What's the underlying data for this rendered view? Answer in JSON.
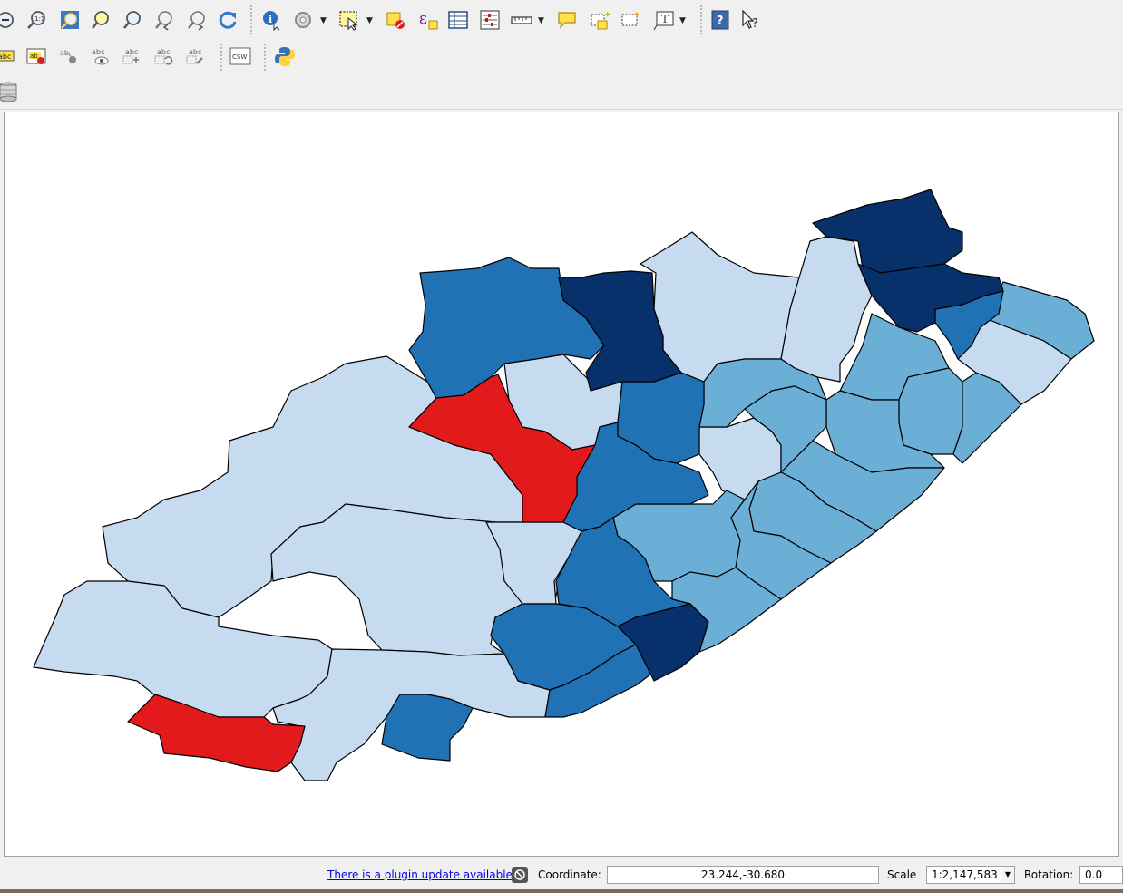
{
  "toolbar_row1": {
    "icons": [
      "zoom-out-icon",
      "zoom-native-resolution-icon",
      "zoom-full-icon",
      "zoom-to-selection-icon",
      "zoom-to-layer-icon",
      "zoom-last-icon",
      "zoom-next-icon",
      "refresh-icon",
      "identify-icon",
      "action-icon",
      "select-features-icon",
      "deselect-icon",
      "select-by-expression-icon",
      "attribute-table-icon",
      "statistical-summary-icon",
      "measure-icon",
      "map-tips-icon",
      "new-bookmark-icon",
      "show-bookmarks-icon",
      "text-annotation-icon",
      "help-icon",
      "whats-this-icon"
    ]
  },
  "toolbar_row2": {
    "icons": [
      "layer-labeling-icon",
      "layer-diagram-icon",
      "pin-labels-icon",
      "show-hide-labels-icon",
      "move-label-icon",
      "rotate-label-icon",
      "change-label-icon",
      "csw-icon",
      "python-console-icon"
    ],
    "csw_label": "CSW"
  },
  "toolbar_row3": {
    "icons": [
      "database-icon"
    ]
  },
  "map": {
    "background": "#ffffff",
    "legend_colors": {
      "class_1": "#c6dbef",
      "class_2": "#6baed6",
      "class_3": "#2171b5",
      "class_4": "#08306b",
      "highlight": "#e31a1c"
    }
  },
  "statusbar": {
    "plugin_update_text": "There is a plugin update available",
    "coordinate_label": "Coordinate:",
    "coordinate_value": "23.244,-30.680",
    "scale_label": "Scale",
    "scale_value": "1:2,147,583",
    "rotation_label": "Rotation:",
    "rotation_value": "0.0"
  }
}
